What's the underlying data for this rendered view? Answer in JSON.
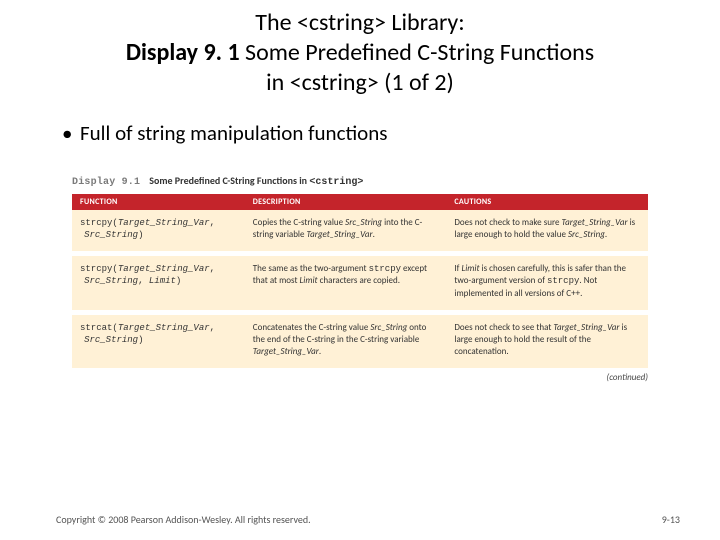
{
  "title": {
    "line1": "The <cstring> Library:",
    "line2_bold": "Display 9. 1",
    "line2_rest": "  Some Predefined C-String Functions",
    "line3": "in <cstring> (1 of 2)"
  },
  "bullet": "Full of string manipulation functions",
  "caption": {
    "num": "Display 9.1",
    "title_a": "Some Predefined C-String Functions in ",
    "title_mono": "<cstring>"
  },
  "headers": {
    "function": "FUNCTION",
    "description": "DESCRIPTION",
    "cautions": "CAUTIONS"
  },
  "rows": [
    {
      "func_mono": "strcpy(",
      "func_arg1": "Target_String_Var",
      "func_sep1": ",",
      "func_arg2": "Src_String",
      "func_close": ")",
      "desc_a": "Copies the C-string value ",
      "desc_i1": "Src_String",
      "desc_b": " into the C-string variable ",
      "desc_i2": "Target_String_Var",
      "desc_c": ".",
      "caut_a": "Does not check to make sure ",
      "caut_i1": "Target_String_Var",
      "caut_b": " is large enough to hold the value ",
      "caut_i2": "Src_String",
      "caut_c": "."
    },
    {
      "func_mono": "strcpy(",
      "func_arg1": "Target_String_Var",
      "func_sep1": ",",
      "func_arg2": "Src_String",
      "func_sep2": ", ",
      "func_arg3": "Limit",
      "func_close": ")",
      "desc_a": "The same as the two-argument ",
      "desc_m1": "strcpy",
      "desc_b": " except that at most ",
      "desc_i1": "Limit",
      "desc_c": " characters are copied.",
      "caut_a": "If ",
      "caut_i1": "Limit",
      "caut_b": " is chosen carefully, this is safer than the two-argument version of ",
      "caut_m1": "strcpy",
      "caut_c": ". Not implemented in all versions of C++."
    },
    {
      "func_mono": "strcat(",
      "func_arg1": "Target_String_Var",
      "func_sep1": ",",
      "func_arg2": "Src_String",
      "func_close": ")",
      "desc_a": "Concatenates the C-string value ",
      "desc_i1": "Src_String",
      "desc_b": " onto the end of the C-string in the C-string variable ",
      "desc_i2": "Target_String_Var",
      "desc_c": ".",
      "caut_a": "Does not check to see that ",
      "caut_i1": "Target_String_Var",
      "caut_b": " is large enough to hold the result of the concatenation.",
      "caut_i2": "",
      "caut_c": ""
    }
  ],
  "continued": "(continued)",
  "footer": {
    "copyright": "Copyright © 2008 Pearson Addison-Wesley. All rights reserved.",
    "pagenum": "9-13"
  }
}
